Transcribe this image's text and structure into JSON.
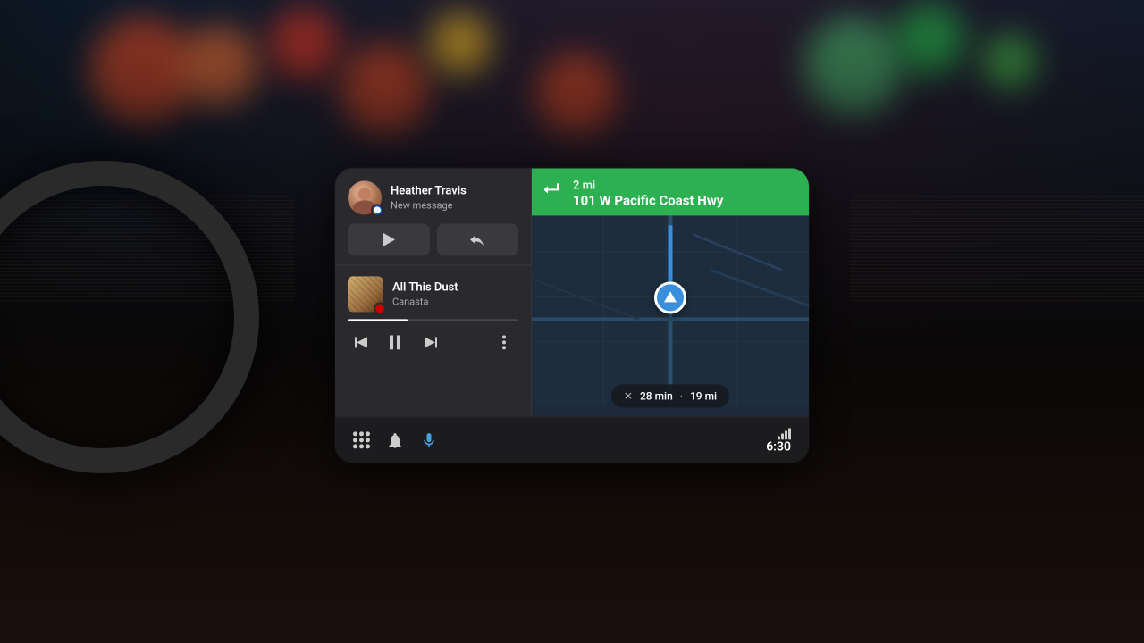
{
  "background": {
    "bokeh_colors": [
      "#cc4422",
      "#dd6633",
      "#cc3322",
      "#44aa66",
      "#22aa44",
      "#ddaa22"
    ]
  },
  "screen": {
    "message_card": {
      "contact_name": "Heather Travis",
      "message_label": "New message",
      "play_label": "▶",
      "reply_label": "↩"
    },
    "music_card": {
      "song_title": "All This Dust",
      "artist": "Canasta",
      "progress": "35"
    },
    "navigation": {
      "distance": "2 mi",
      "street": "101 W Pacific Coast Hwy",
      "eta_time": "28 min",
      "eta_distance": "19 mi"
    },
    "bottom_bar": {
      "time": "6:30"
    },
    "music_controls": {
      "prev": "⏮",
      "pause": "⏸",
      "next": "⏭",
      "more": "⋮"
    }
  }
}
